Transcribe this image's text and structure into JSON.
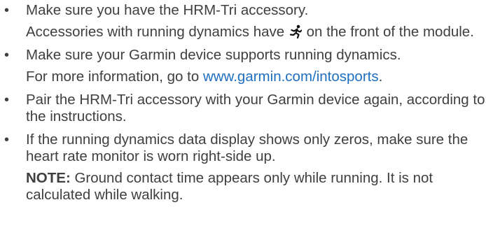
{
  "items": [
    {
      "bullet": "•",
      "text": "Make sure you have the HRM-Tri accessory.",
      "sub_before": "Accessories with running dynamics have",
      "sub_icon": "running-dynamics-icon",
      "sub_after": "on the front of the module."
    },
    {
      "bullet": "•",
      "text": "Make sure your Garmin device supports running dynamics.",
      "sub_before": "For more information, go to",
      "link_text": "www.garmin.com/intosports",
      "sub_after": "."
    },
    {
      "bullet": "•",
      "text": "Pair the HRM-Tri accessory with your Garmin device again, according to the instructions."
    },
    {
      "bullet": "•",
      "text": "If the running dynamics data display shows only zeros, make sure the heart rate monitor is worn right-side up.",
      "note_label": "NOTE:",
      "note_text": "Ground contact time appears only while running. It is not calculated while walking."
    }
  ],
  "colors": {
    "text": "#3f3f3f",
    "link": "#1f6fc0"
  }
}
